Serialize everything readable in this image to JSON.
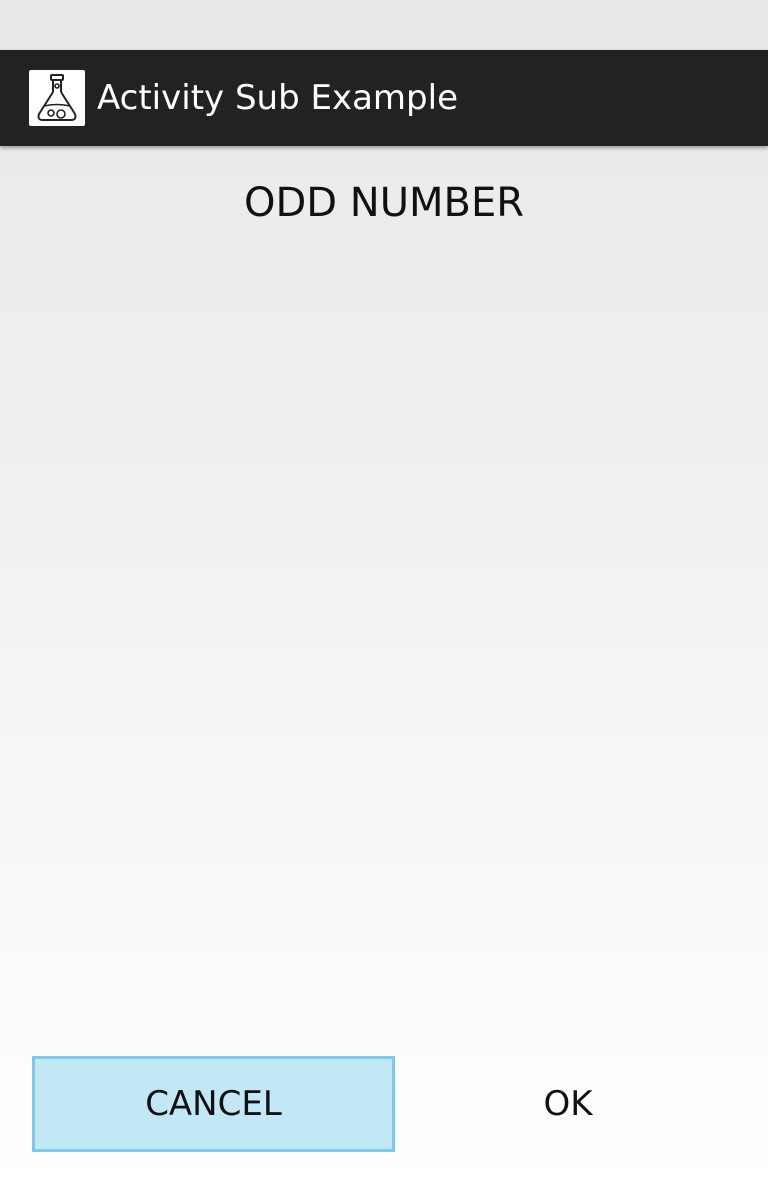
{
  "status_bar": {},
  "action_bar": {
    "app_icon": "flask-icon",
    "title": "Activity Sub Example"
  },
  "content": {
    "message": "ODD NUMBER"
  },
  "buttons": {
    "cancel_label": "CANCEL",
    "ok_label": "OK"
  },
  "colors": {
    "action_bar_bg": "#222222",
    "cancel_pressed_bg": "#c2e7f6",
    "cancel_pressed_border": "#7ec9ea"
  }
}
